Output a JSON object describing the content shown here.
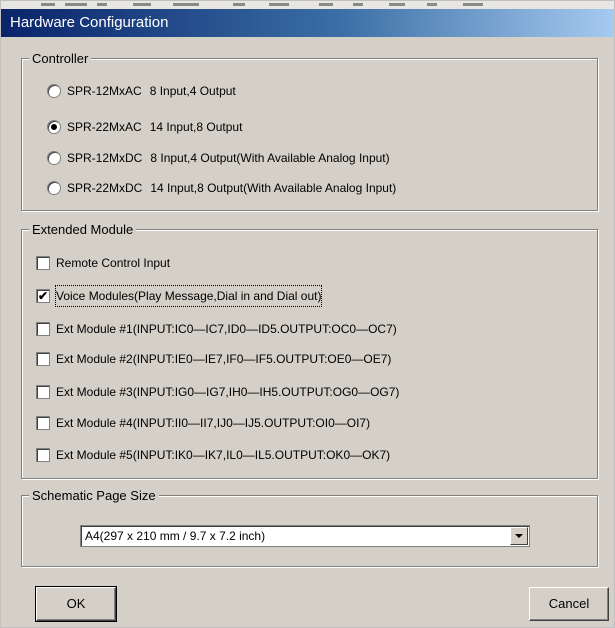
{
  "window": {
    "title": "Hardware Configuration"
  },
  "controller": {
    "legend": "Controller",
    "options": [
      {
        "model": "SPR-12MxAC",
        "desc": "8  Input,4 Output",
        "checked": false
      },
      {
        "model": "SPR-22MxAC",
        "desc": "14 Input,8 Output",
        "checked": true
      },
      {
        "model": "SPR-12MxDC",
        "desc": "8  Input,4 Output(With Available Analog Input)",
        "checked": false
      },
      {
        "model": "SPR-22MxDC",
        "desc": "14 Input,8 Output(With Available Analog Input)",
        "checked": false
      }
    ]
  },
  "extended_module": {
    "legend": "Extended Module",
    "items": [
      {
        "label": "Remote Control Input",
        "checked": false
      },
      {
        "label": "Voice Modules(Play Message,Dial in and Dial out)",
        "checked": true
      },
      {
        "label": "Ext Module #1(INPUT:IC0—IC7,ID0—ID5.OUTPUT:OC0—OC7)",
        "checked": false
      },
      {
        "label": "Ext Module #2(INPUT:IE0—IE7,IF0—IF5.OUTPUT:OE0—OE7)",
        "checked": false
      },
      {
        "label": "Ext Module #3(INPUT:IG0—IG7,IH0—IH5.OUTPUT:OG0—OG7)",
        "checked": false
      },
      {
        "label": "Ext Module #4(INPUT:II0—II7,IJ0—IJ5.OUTPUT:OI0—OI7)",
        "checked": false
      },
      {
        "label": "Ext Module #5(INPUT:IK0—IK7,IL0—IL5.OUTPUT:OK0—OK7)",
        "checked": false
      }
    ]
  },
  "page_size": {
    "legend": "Schematic Page Size",
    "selected": "A4(297 x 210 mm / 9.7 x 7.2 inch)"
  },
  "buttons": {
    "ok": "OK",
    "cancel": "Cancel"
  },
  "icons": {
    "combo_arrow": "chevron-down-icon",
    "check_mark": "check-icon"
  },
  "colors": {
    "dialog_face": "#d4d0c8",
    "title_start": "#0a246a",
    "title_end": "#a6caf0"
  }
}
